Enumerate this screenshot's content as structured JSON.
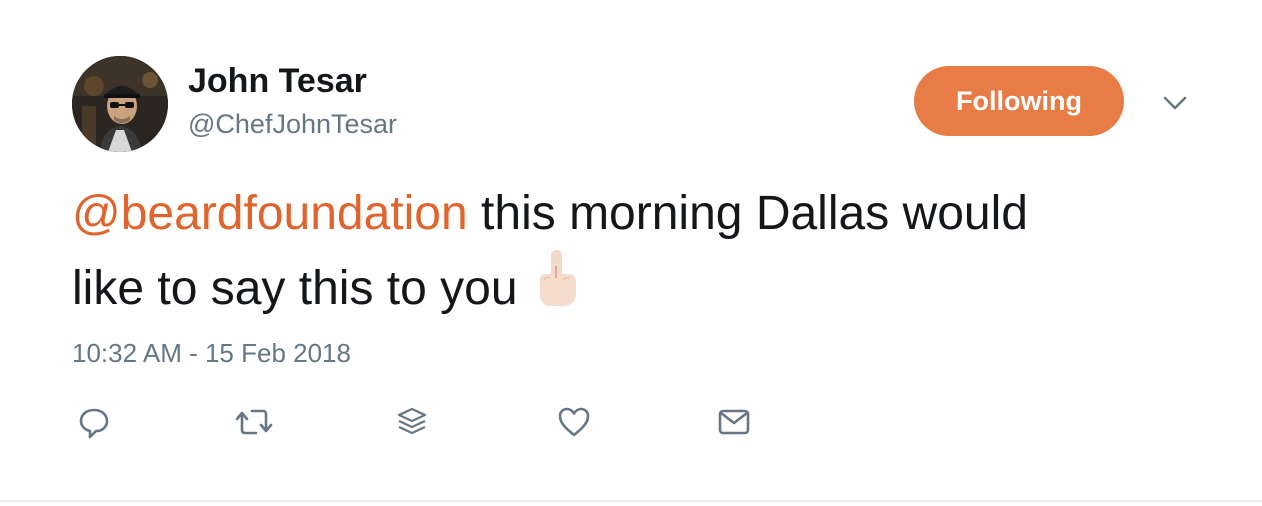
{
  "author": {
    "display_name": "John Tesar",
    "handle": "@ChefJohnTesar"
  },
  "follow_button": {
    "label": "Following"
  },
  "tweet": {
    "mention": "@beardfoundation",
    "text_line1": " this morning Dallas would",
    "text_line2": "like to say this to you",
    "emoji": "middle-finger-emoji",
    "timestamp": "10:32 AM - 15 Feb 2018"
  },
  "actions": [
    "reply-icon",
    "retweet-icon",
    "stack-icon",
    "like-icon",
    "message-icon"
  ],
  "colors": {
    "accent": "#e87c46",
    "mention": "#e0642e",
    "secondary_text": "#657786",
    "primary_text": "#14171a"
  }
}
